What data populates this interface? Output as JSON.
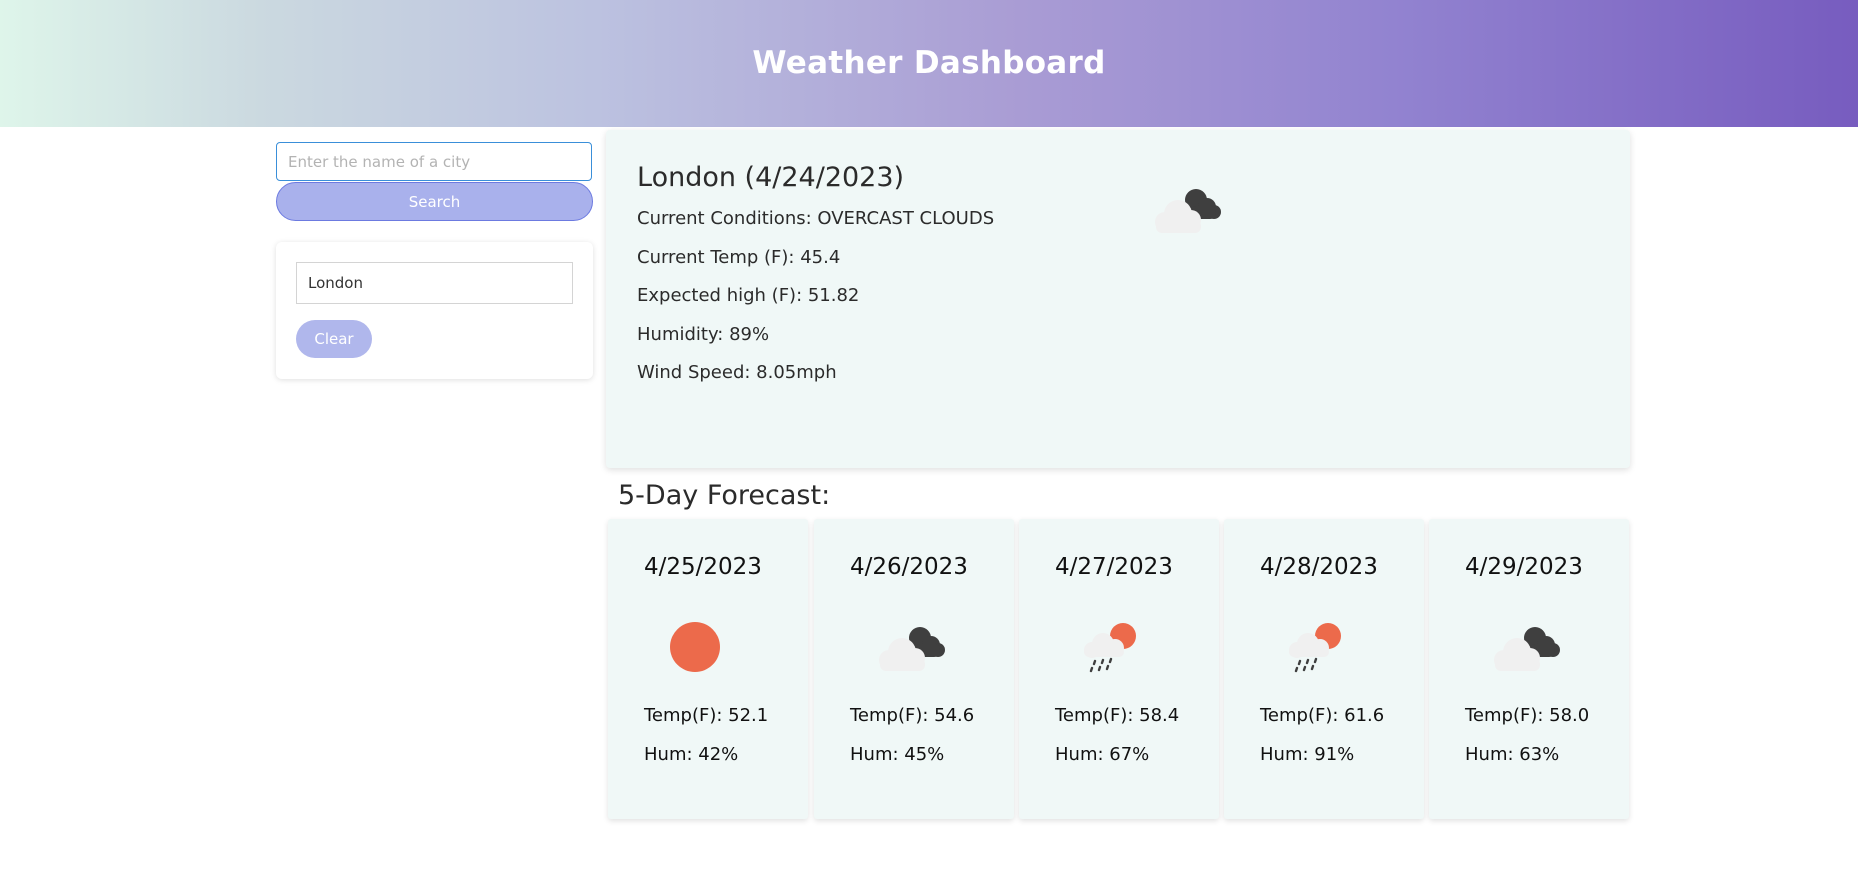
{
  "header": {
    "title": "Weather Dashboard"
  },
  "search": {
    "placeholder": "Enter the name of a city",
    "value": "",
    "button_label": "Search"
  },
  "history": {
    "items": [
      {
        "label": "London"
      }
    ],
    "clear_label": "Clear"
  },
  "current": {
    "title": "London (4/24/2023)",
    "conditions": "Current Conditions: OVERCAST CLOUDS",
    "temp": "Current Temp (F): 45.4",
    "high": "Expected high (F): 51.82",
    "humidity": "Humidity: 89%",
    "wind": "Wind Speed: 8.05mph",
    "icon": "overcast-clouds-icon"
  },
  "forecast": {
    "heading": "5-Day Forecast:",
    "days": [
      {
        "date": "4/25/2023",
        "icon": "clear-sky-icon",
        "temp": "Temp(F): 52.1",
        "hum": "Hum: 42%"
      },
      {
        "date": "4/26/2023",
        "icon": "overcast-clouds-icon",
        "temp": "Temp(F): 54.6",
        "hum": "Hum: 45%"
      },
      {
        "date": "4/27/2023",
        "icon": "rain-sun-icon",
        "temp": "Temp(F): 58.4",
        "hum": "Hum: 67%"
      },
      {
        "date": "4/28/2023",
        "icon": "rain-sun-icon",
        "temp": "Temp(F): 61.6",
        "hum": "Hum: 91%"
      },
      {
        "date": "4/29/2023",
        "icon": "overcast-clouds-icon",
        "temp": "Temp(F): 58.0",
        "hum": "Hum: 63%"
      }
    ]
  },
  "colors": {
    "accent": "#a9b1ec",
    "card_bg": "#f0f8f7",
    "sun": "#ec6a4b",
    "dark_cloud": "#3f3f3f",
    "light_cloud": "#f0f0f0"
  }
}
